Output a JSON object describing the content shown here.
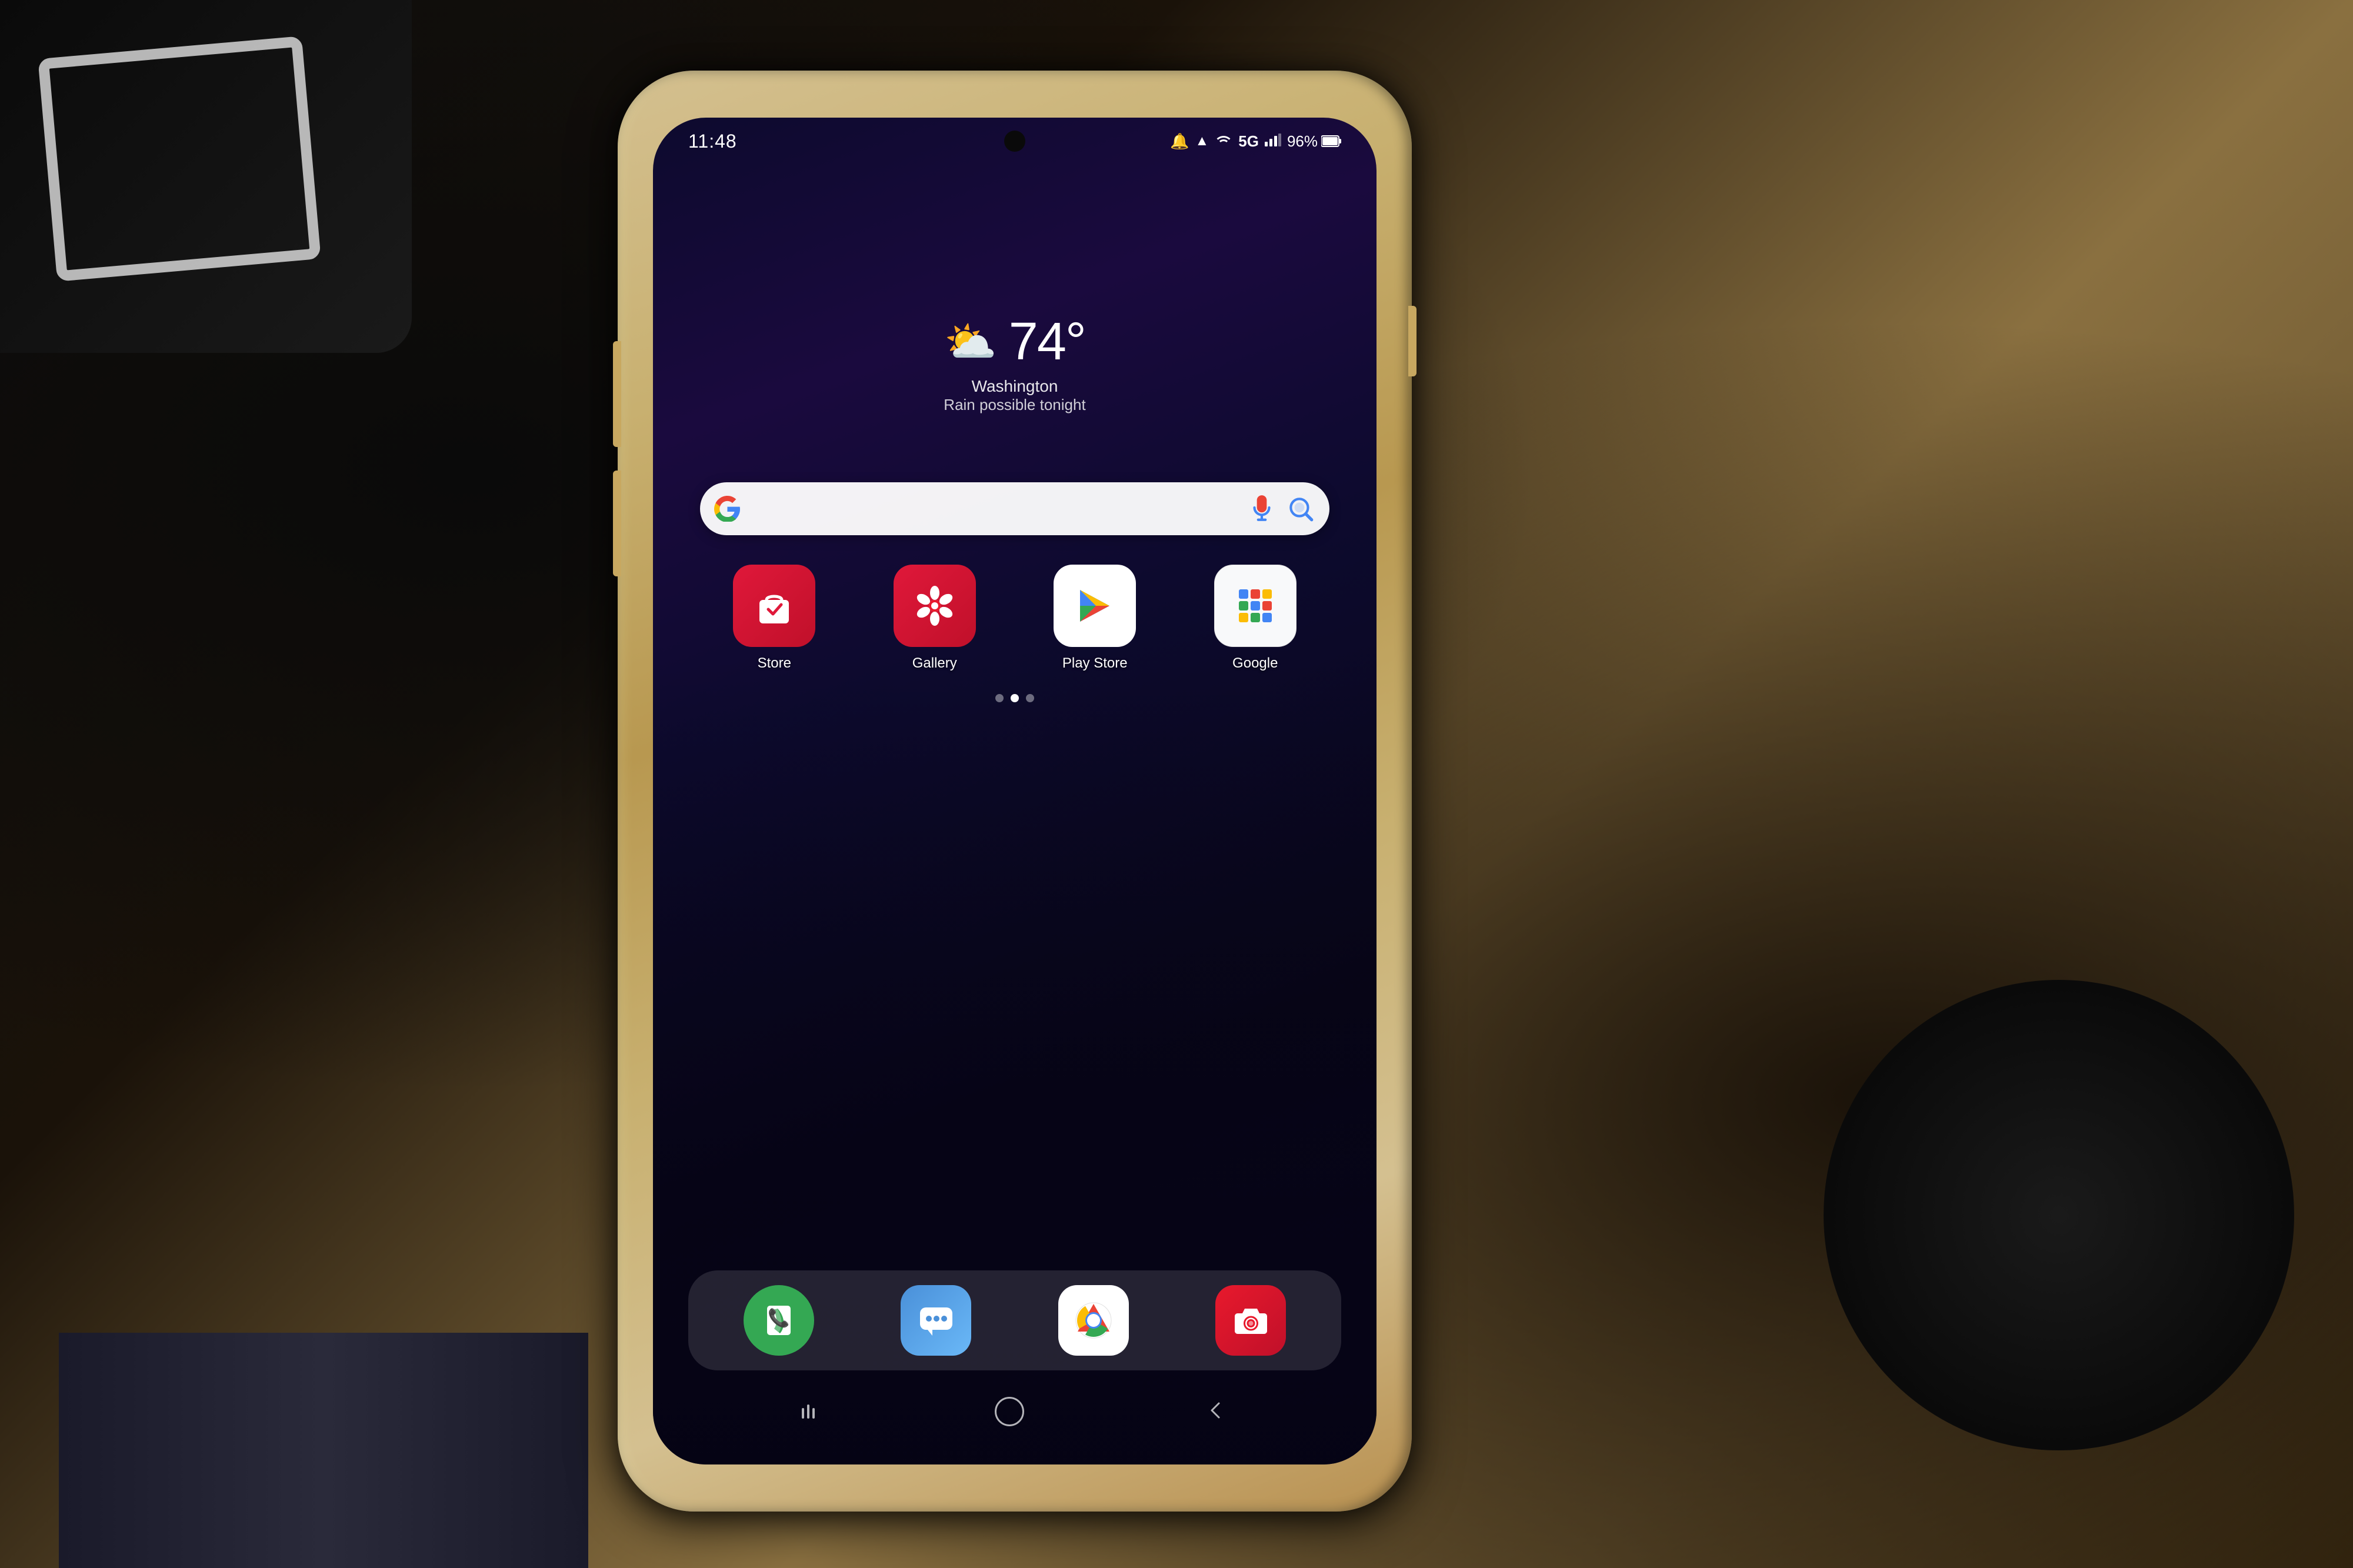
{
  "background": {
    "color": "#2a1f0e"
  },
  "phone": {
    "status_bar": {
      "time": "11:48",
      "icons": "🔔 ▲ ▼ WiFi",
      "signal": "5G",
      "battery": "96%",
      "time_value": "11:48",
      "battery_value": "96%",
      "signal_text": "5G"
    },
    "weather": {
      "icon": "⛅",
      "temperature": "74°",
      "location": "Washington",
      "description": "Rain possible tonight"
    },
    "search_bar": {
      "placeholder": "Search"
    },
    "apps": [
      {
        "name": "Store",
        "icon_type": "store",
        "bg_color": "#e8192c"
      },
      {
        "name": "Gallery",
        "icon_type": "gallery",
        "bg_color": "#e8192c"
      },
      {
        "name": "Play Store",
        "icon_type": "playstore",
        "bg_color": "#ffffff"
      },
      {
        "name": "Google",
        "icon_type": "google",
        "bg_color": "#f8f9fa"
      }
    ],
    "dock": [
      {
        "name": "Phone",
        "icon_type": "phone",
        "bg_color": "#34a853"
      },
      {
        "name": "Messages",
        "icon_type": "messages",
        "bg_color": "#4285f4"
      },
      {
        "name": "Chrome",
        "icon_type": "chrome",
        "bg_color": "#ffffff"
      },
      {
        "name": "Camera",
        "icon_type": "camera",
        "bg_color": "#e8192c"
      }
    ],
    "nav": {
      "back": "‹",
      "home": "○",
      "recents": "|||"
    },
    "page_dots": [
      {
        "active": false
      },
      {
        "active": true
      },
      {
        "active": false
      }
    ]
  }
}
